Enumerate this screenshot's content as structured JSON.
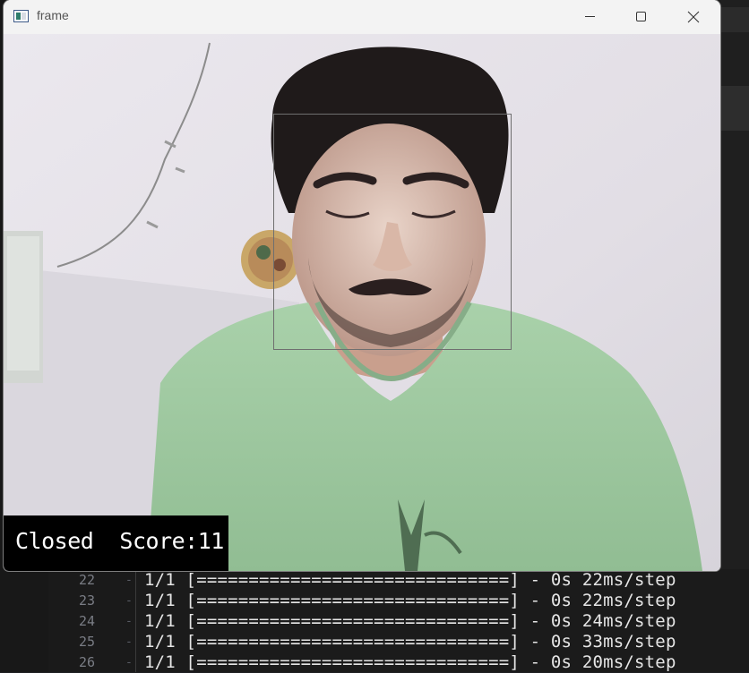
{
  "window": {
    "title": "frame",
    "controls": [
      "minimize",
      "maximize",
      "close"
    ]
  },
  "video": {
    "status_text": "Closed  Score:11",
    "face_detected": true
  },
  "terminal": {
    "lines": [
      {
        "num": "22",
        "marker": "-",
        "text": "1/1 [==============================] - 0s 22ms/step"
      },
      {
        "num": "23",
        "marker": "-",
        "text": "1/1 [==============================] - 0s 22ms/step"
      },
      {
        "num": "24",
        "marker": "-",
        "text": "1/1 [==============================] - 0s 24ms/step"
      },
      {
        "num": "25",
        "marker": "-",
        "text": "1/1 [==============================] - 0s 33ms/step"
      },
      {
        "num": "26",
        "marker": "-",
        "text": "1/1 [==============================] - 0s 20ms/step"
      }
    ]
  },
  "colors": {
    "terminal_bg": "#1b1b1b",
    "terminal_text": "#e6e6e6",
    "shirt": "#9fc9a0",
    "status_bg": "#000000",
    "status_text": "#ffffff"
  },
  "icons": {
    "app": "opencv-window-icon",
    "minimize": "minimize-icon",
    "maximize": "maximize-icon",
    "close": "close-icon"
  }
}
